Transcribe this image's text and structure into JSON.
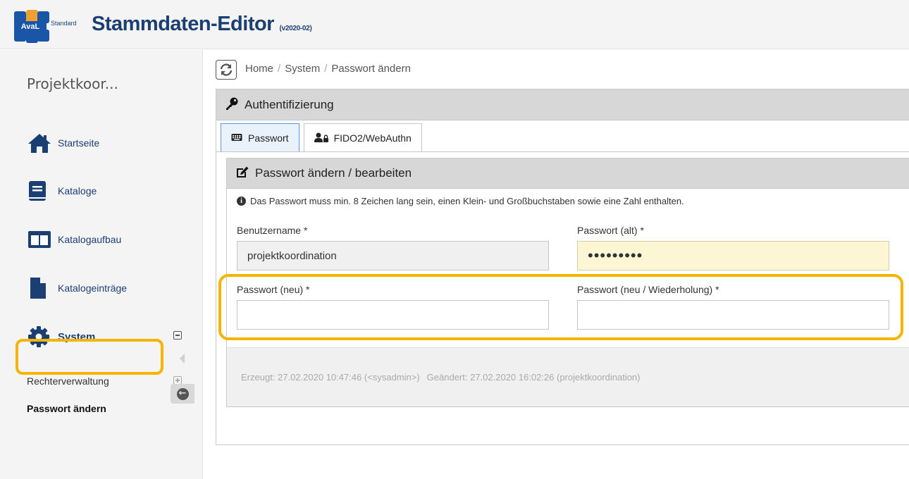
{
  "app": {
    "logo_text": "AvaL",
    "logo_sub": "Standard",
    "title": "Stammdaten-Editor",
    "version": "(v2020-02)"
  },
  "colors": {
    "brand": "#1b3e73",
    "logo_blue": "#1a56a8",
    "logo_orange": "#f0a030",
    "highlight": "#f5b400"
  },
  "sidebar": {
    "user": "Projektkoor...",
    "items": [
      {
        "label": "Startseite",
        "icon": "home-icon"
      },
      {
        "label": "Kataloge",
        "icon": "book-icon"
      },
      {
        "label": "Katalogaufbau",
        "icon": "columns-icon"
      },
      {
        "label": "Katalogeinträge",
        "icon": "file-icon"
      },
      {
        "label": "System",
        "icon": "gear-icon"
      }
    ],
    "sub_items": [
      {
        "label": "Rechterverwaltung"
      },
      {
        "label": "Passwort ändern"
      }
    ]
  },
  "breadcrumb": {
    "home": "Home",
    "system": "System",
    "current": "Passwort ändern",
    "sep": "/"
  },
  "panel": {
    "title": "Authentifizierung",
    "tabs": [
      {
        "label": "Passwort",
        "icon": "keyboard-icon"
      },
      {
        "label": "FIDO2/WebAuthn",
        "icon": "users-lock-icon"
      }
    ]
  },
  "form": {
    "title": "Passwort ändern / bearbeiten",
    "info": "Das Passwort muss min. 8 Zeichen lang sein, einen Klein- und Großbuchstaben sowie eine Zahl enthalten.",
    "username_label": "Benutzername *",
    "username_value": "projektkoordination",
    "old_pw_label": "Passwort (alt) *",
    "old_pw_value": "•••••••••",
    "new_pw_label": "Passwort (neu) *",
    "new_pw_value": "",
    "repeat_pw_label": "Passwort (neu / Wiederholung) *",
    "repeat_pw_value": ""
  },
  "meta": {
    "created": "Erzeugt: 27.02.2020 10:47:46 (<sysadmin>)",
    "changed": "Geändert: 27.02.2020 16:02:26 (projektkoordination)"
  }
}
